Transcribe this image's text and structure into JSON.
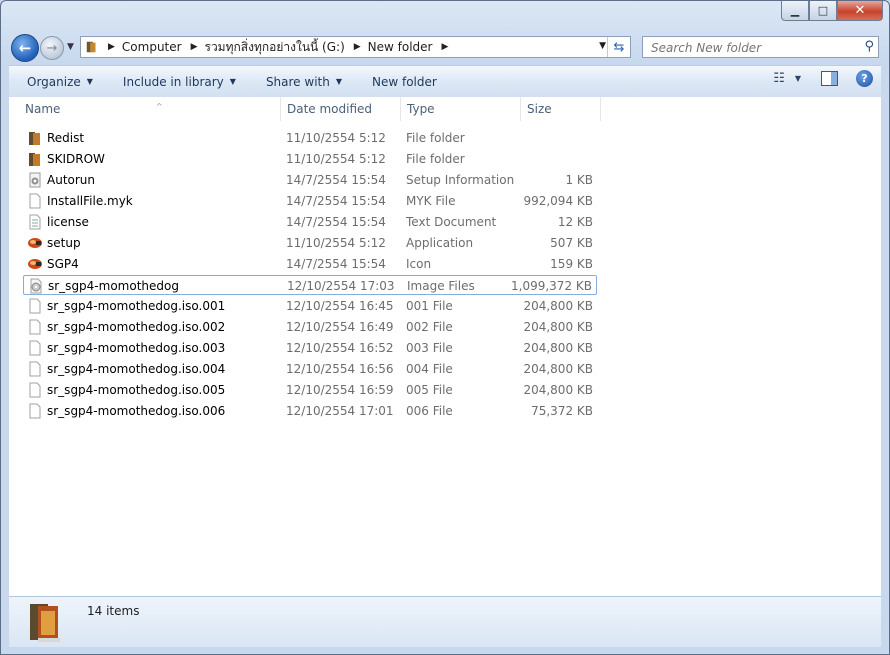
{
  "nav": {
    "breadcrumbs": [
      "Computer",
      "รวมทุกสิ่งทุกอย่างในนี้ (G:)",
      "New folder"
    ]
  },
  "search": {
    "placeholder": "Search New folder"
  },
  "toolbar": {
    "organize": "Organize",
    "include_in_library": "Include in library",
    "share_with": "Share with",
    "new_folder": "New folder"
  },
  "columns": {
    "name": "Name",
    "date": "Date modified",
    "type": "Type",
    "size": "Size"
  },
  "files": [
    {
      "name": "Redist",
      "date": "11/10/2554 5:12",
      "type": "File folder",
      "size": "",
      "icon": "folder-icon"
    },
    {
      "name": "SKIDROW",
      "date": "11/10/2554 5:12",
      "type": "File folder",
      "size": "",
      "icon": "folder-icon"
    },
    {
      "name": "Autorun",
      "date": "14/7/2554 15:54",
      "type": "Setup Information",
      "size": "1 KB",
      "icon": "setup-info-icon"
    },
    {
      "name": "InstallFile.myk",
      "date": "14/7/2554 15:54",
      "type": "MYK File",
      "size": "992,094 KB",
      "icon": "blank-file-icon"
    },
    {
      "name": "license",
      "date": "14/7/2554 15:54",
      "type": "Text Document",
      "size": "12 KB",
      "icon": "text-document-icon"
    },
    {
      "name": "setup",
      "date": "11/10/2554 5:12",
      "type": "Application",
      "size": "507 KB",
      "icon": "application-icon"
    },
    {
      "name": "SGP4",
      "date": "14/7/2554 15:54",
      "type": "Icon",
      "size": "159 KB",
      "icon": "application-icon"
    },
    {
      "name": "sr_sgp4-momothedog",
      "date": "12/10/2554 17:03",
      "type": "Image Files",
      "size": "1,099,372 KB",
      "icon": "disc-image-icon"
    },
    {
      "name": "sr_sgp4-momothedog.iso.001",
      "date": "12/10/2554 16:45",
      "type": "001 File",
      "size": "204,800 KB",
      "icon": "blank-file-icon"
    },
    {
      "name": "sr_sgp4-momothedog.iso.002",
      "date": "12/10/2554 16:49",
      "type": "002 File",
      "size": "204,800 KB",
      "icon": "blank-file-icon"
    },
    {
      "name": "sr_sgp4-momothedog.iso.003",
      "date": "12/10/2554 16:52",
      "type": "003 File",
      "size": "204,800 KB",
      "icon": "blank-file-icon"
    },
    {
      "name": "sr_sgp4-momothedog.iso.004",
      "date": "12/10/2554 16:56",
      "type": "004 File",
      "size": "204,800 KB",
      "icon": "blank-file-icon"
    },
    {
      "name": "sr_sgp4-momothedog.iso.005",
      "date": "12/10/2554 16:59",
      "type": "005 File",
      "size": "204,800 KB",
      "icon": "blank-file-icon"
    },
    {
      "name": "sr_sgp4-momothedog.iso.006",
      "date": "12/10/2554 17:01",
      "type": "006 File",
      "size": "75,372 KB",
      "icon": "blank-file-icon"
    }
  ],
  "status": {
    "item_count": "14 items"
  }
}
